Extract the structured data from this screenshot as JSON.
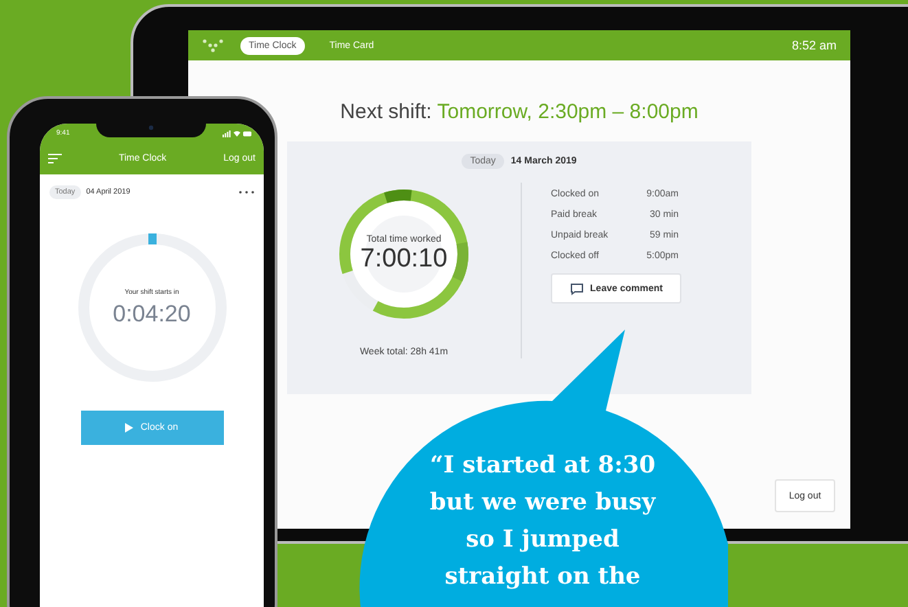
{
  "tablet": {
    "tabs": [
      {
        "label": "Time Clock",
        "selected": true
      },
      {
        "label": "Time Card",
        "selected": false
      }
    ],
    "clock": "8:52 am",
    "next_shift": {
      "label": "Next shift:",
      "value": "Tomorrow, 2:30pm – 8:00pm"
    },
    "summary": {
      "today_chip": "Today",
      "date": "14 March 2019",
      "ring_label": "Total time worked",
      "total": "7:00:10",
      "week_total": "Week total: 28h 41m",
      "details": [
        {
          "label": "Clocked on",
          "value": "9:00am"
        },
        {
          "label": "Paid break",
          "value": "30 min"
        },
        {
          "label": "Unpaid break",
          "value": "59 min"
        },
        {
          "label": "Clocked off",
          "value": "5:00pm"
        }
      ],
      "comment_button": "Leave comment"
    },
    "logout_button": "Log out"
  },
  "phone": {
    "status_time": "9:41",
    "title": "Time Clock",
    "logout": "Log out",
    "today_chip": "Today",
    "date": "04 April 2019",
    "countdown_label": "Your shift starts in",
    "countdown": "0:04:20",
    "clock_on_button": "Clock on"
  },
  "quote": "“I started at 8:30 but we were busy so I jumped straight on the"
}
